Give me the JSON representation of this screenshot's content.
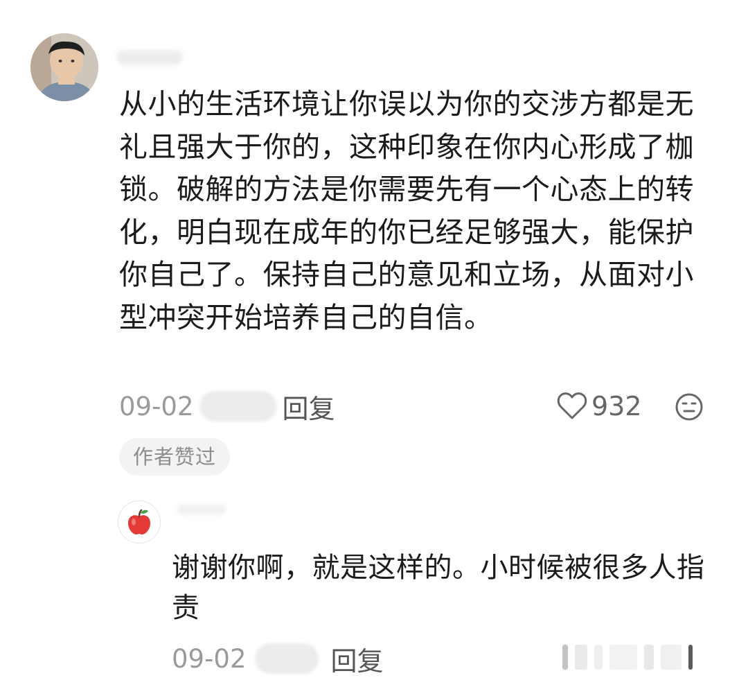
{
  "comment": {
    "text": "从小的生活环境让你误以为你的交涉方都是无礼且强大于你的，这种印象在你内心形成了枷锁。破解的方法是你需要先有一个心态上的转化，明白现在成年的你已经足够强大，能保护你自己了。保持自己的意见和立场，从面对小型冲突开始培养自己的自信。",
    "date": "09-02",
    "reply_label": "回复",
    "like_count": "932",
    "badge": "作者赞过",
    "icons": {
      "like": "heart-outline-icon",
      "dislike": "meh-face-icon"
    }
  },
  "reply": {
    "text": "谢谢你啊，就是这样的。小时候被很多人指责",
    "date": "09-02",
    "reply_label": "回复",
    "avatar_icon": "apple-icon"
  },
  "colors": {
    "text": "#1b1b1b",
    "meta": "#9b9b9b",
    "reply_link": "#555555",
    "badge_bg": "#f3f3f3",
    "apple_red": "#e53935"
  }
}
